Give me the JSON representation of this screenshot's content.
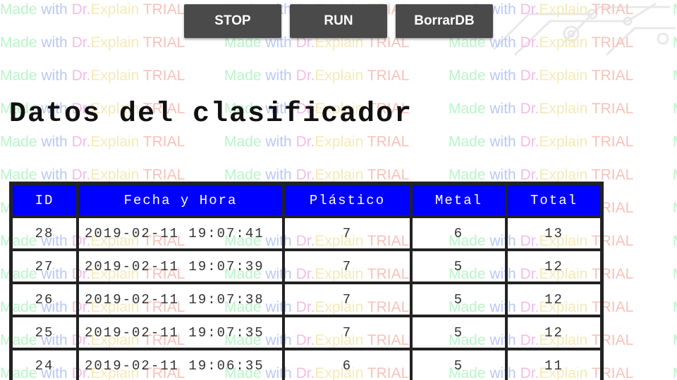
{
  "watermark_text_parts": [
    "Made",
    "with",
    "Dr.",
    "Explain",
    "TRIAL"
  ],
  "toolbar": {
    "stop_label": "STOP",
    "run_label": "RUN",
    "borrar_label": "BorrarDB"
  },
  "page": {
    "title": "Datos del clasificador"
  },
  "table": {
    "headers": [
      "ID",
      "Fecha y Hora",
      "Plástico",
      "Metal",
      "Total"
    ],
    "rows": [
      [
        "28",
        "2019-02-11 19:07:41",
        "7",
        "6",
        "13"
      ],
      [
        "27",
        "2019-02-11 19:07:39",
        "7",
        "5",
        "12"
      ],
      [
        "26",
        "2019-02-11 19:07:38",
        "7",
        "5",
        "12"
      ],
      [
        "25",
        "2019-02-11 19:07:35",
        "7",
        "5",
        "12"
      ],
      [
        "24",
        "2019-02-11 19:06:35",
        "6",
        "5",
        "11"
      ]
    ]
  },
  "colors": {
    "header_bg": "#0000ff",
    "button_bg": "#4a4a4a"
  }
}
